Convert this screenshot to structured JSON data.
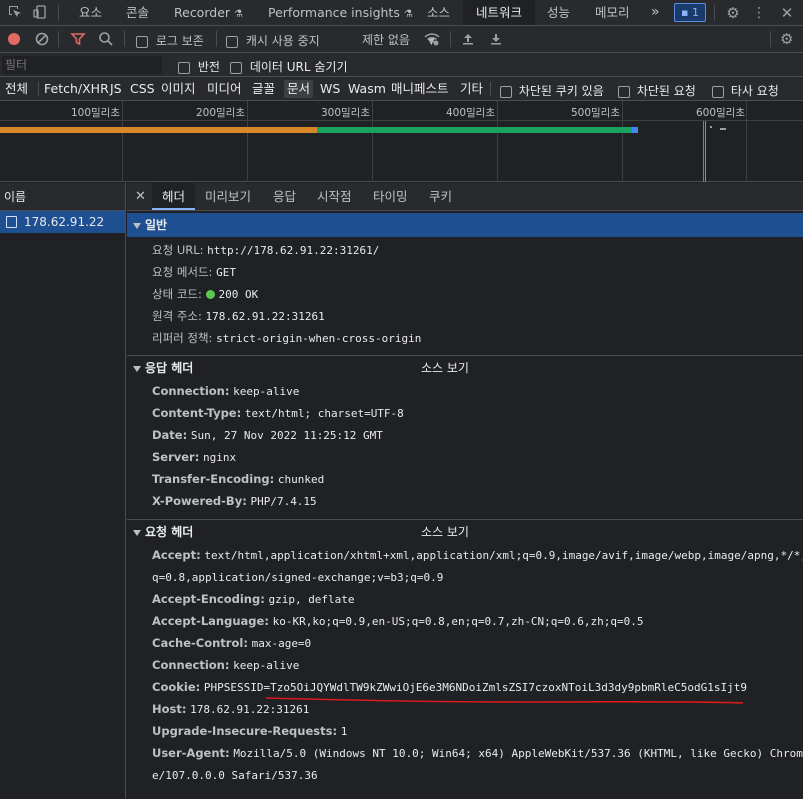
{
  "tabbar": {
    "tabs": [
      "요소",
      "콘솔",
      "Recorder",
      "Performance insights",
      "소스",
      "네트워크",
      "성능",
      "메모리"
    ],
    "active_tab": "네트워크",
    "more": "»",
    "issues_count": "1"
  },
  "toolbar": {
    "preserve_log": "로그 보존",
    "disable_cache": "캐시 사용 중지",
    "throttle": "제한 없음"
  },
  "filter": {
    "placeholder": "필터",
    "invert": "반전",
    "hide_data_urls": "데이터 URL 숨기기"
  },
  "types": {
    "items": [
      "전체",
      "Fetch/XHR",
      "JS",
      "CSS",
      "이미지",
      "미디어",
      "글꼴",
      "문서",
      "WS",
      "Wasm",
      "매니페스트",
      "기타"
    ],
    "selected": "문서",
    "blocked_cookies": "차단된 쿠키 있음",
    "blocked_requests": "차단된 요청",
    "third_party": "타사 요청"
  },
  "timeline": {
    "ticks": [
      "100밀리초",
      "200밀리초",
      "300밀리초",
      "400밀리초",
      "500밀리초",
      "600밀리초"
    ]
  },
  "requests": {
    "header": "이름",
    "items": [
      "178.62.91.22"
    ]
  },
  "details": {
    "tabs": [
      "헤더",
      "미리보기",
      "응답",
      "시작점",
      "타이밍",
      "쿠키"
    ],
    "active_tab": "헤더",
    "general": {
      "title": "일반",
      "rows": [
        {
          "k": "요청 URL:",
          "v": "http://178.62.91.22:31261/"
        },
        {
          "k": "요청 메서드:",
          "v": "GET"
        },
        {
          "k": "상태 코드:",
          "v": "200 OK"
        },
        {
          "k": "원격 주소:",
          "v": "178.62.91.22:31261"
        },
        {
          "k": "리퍼러 정책:",
          "v": "strict-origin-when-cross-origin"
        }
      ]
    },
    "response_headers": {
      "title": "응답 헤더",
      "view_source": "소스 보기",
      "rows": [
        {
          "k": "Connection:",
          "v": "keep-alive"
        },
        {
          "k": "Content-Type:",
          "v": "text/html; charset=UTF-8"
        },
        {
          "k": "Date:",
          "v": "Sun, 27 Nov 2022 11:25:12 GMT"
        },
        {
          "k": "Server:",
          "v": "nginx"
        },
        {
          "k": "Transfer-Encoding:",
          "v": "chunked"
        },
        {
          "k": "X-Powered-By:",
          "v": "PHP/7.4.15"
        }
      ]
    },
    "request_headers": {
      "title": "요청 헤더",
      "view_source": "소스 보기",
      "accept_k": "Accept:",
      "accept_v1": "text/html,application/xhtml+xml,application/xml;q=0.9,image/avif,image/webp,image/apng,*/*;",
      "accept_v2": "q=0.8,application/signed-exchange;v=b3;q=0.9",
      "rows": [
        {
          "k": "Accept-Encoding:",
          "v": "gzip, deflate"
        },
        {
          "k": "Accept-Language:",
          "v": "ko-KR,ko;q=0.9,en-US;q=0.8,en;q=0.7,zh-CN;q=0.6,zh;q=0.5"
        },
        {
          "k": "Cache-Control:",
          "v": "max-age=0"
        },
        {
          "k": "Connection:",
          "v": "keep-alive"
        },
        {
          "k": "Cookie:",
          "v": "PHPSESSID=Tzo5OiJQYWdlTW9kZWwiOjE6e3M6NDoiZmlsZSI7czoxNToiL3d3dy9pbmRleC5odG1sIjt9"
        },
        {
          "k": "Host:",
          "v": "178.62.91.22:31261"
        },
        {
          "k": "Upgrade-Insecure-Requests:",
          "v": "1"
        }
      ],
      "ua_k": "User-Agent:",
      "ua_v1": "Mozilla/5.0 (Windows NT 10.0; Win64; x64) AppleWebKit/537.36 (KHTML, like Gecko) Chrom",
      "ua_v2": "e/107.0.0.0 Safari/537.36"
    }
  }
}
